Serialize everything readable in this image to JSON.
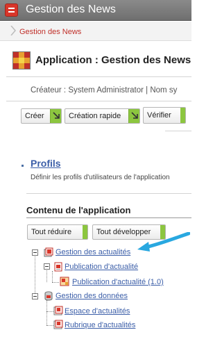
{
  "window": {
    "title": "Gestion des News"
  },
  "breadcrumb": {
    "items": [
      "Gestion des News"
    ]
  },
  "app": {
    "heading": "Application : Gestion des News"
  },
  "meta": {
    "text": "Créateur : System Administrator |  Nom sy"
  },
  "toolbar": {
    "create_label": "Créer",
    "quick_create_label": "Création rapide",
    "verify_label": "Vérifier"
  },
  "profiles": {
    "link_label": "Profils",
    "description": "Définir les profils d'utilisateurs de l'application"
  },
  "content": {
    "title": "Contenu de l'application",
    "collapse_label": "Tout réduire",
    "expand_label": "Tout développer",
    "tree": {
      "news_management": "Gestion des actualités",
      "news_publication": "Publication d'actualité",
      "news_publication_version": "Publication d'actualité (1.0)",
      "data_management": "Gestion des données",
      "news_space": "Espace d'actualités",
      "news_section": "Rubrique d'actualités"
    }
  },
  "colors": {
    "accent_green": "#8cc63f",
    "link_blue": "#3b5ea8",
    "brand_red": "#d9362a",
    "callout_blue": "#29a8e0"
  }
}
